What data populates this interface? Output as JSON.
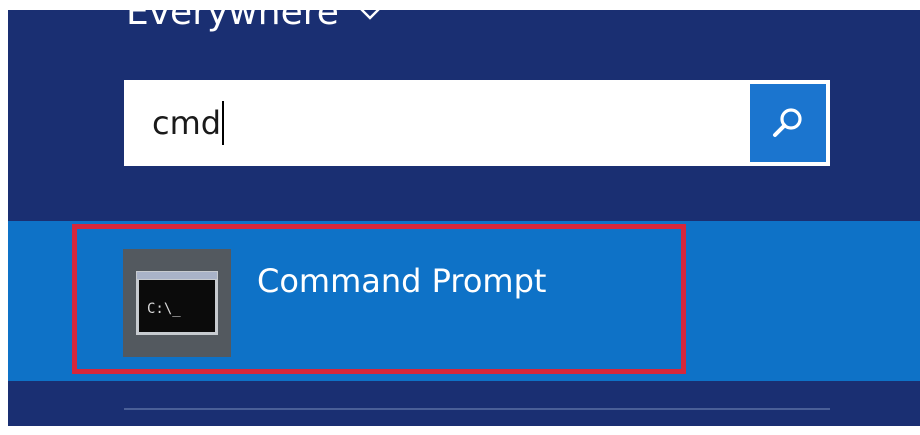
{
  "search_scope": {
    "label": "Everywhere"
  },
  "search": {
    "value": "cmd"
  },
  "results": [
    {
      "label": "Command Prompt",
      "icon_text": "C:\\_"
    }
  ],
  "colors": {
    "panel_background": "#1a2f72",
    "search_button": "#1b75cf",
    "result_band": "#0e72c7",
    "selection_outline": "#d6273b",
    "app_tile": "#53595f"
  },
  "icons": {
    "scope_dropdown": "chevron-down-icon",
    "search_button": "search-icon",
    "result_app": "command-prompt-icon"
  }
}
